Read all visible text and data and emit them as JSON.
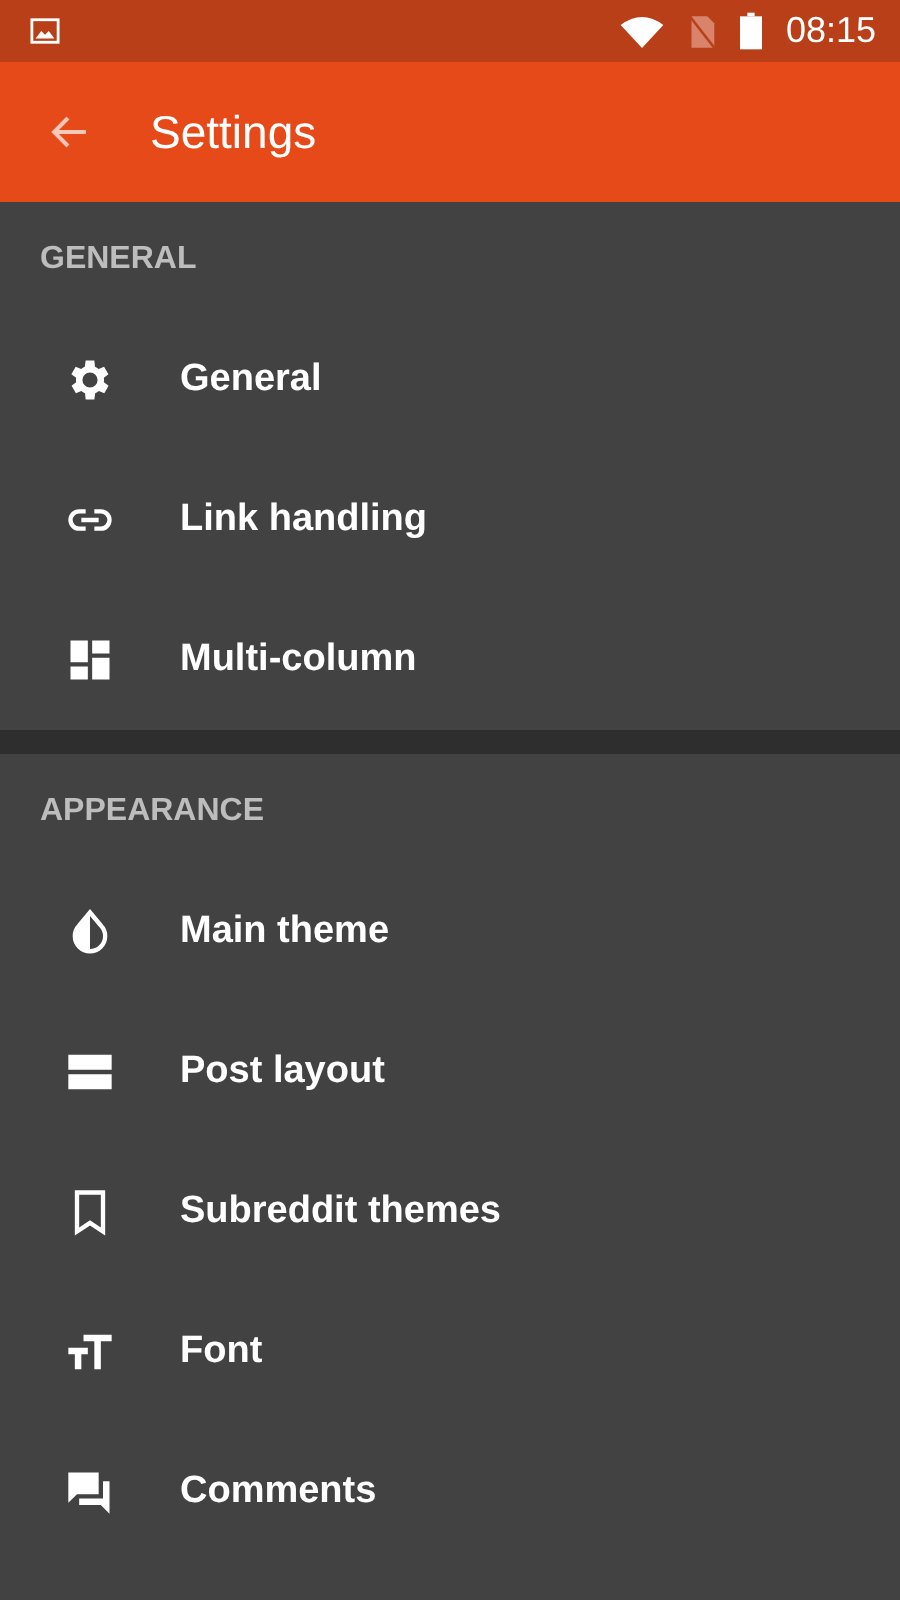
{
  "status_bar": {
    "time": "08:15"
  },
  "toolbar": {
    "title": "Settings"
  },
  "sections": [
    {
      "header": "GENERAL",
      "items": [
        {
          "label": "General",
          "kind": "gear"
        },
        {
          "label": "Link handling",
          "kind": "link"
        },
        {
          "label": "Multi-column",
          "kind": "dashboard"
        }
      ]
    },
    {
      "header": "APPEARANCE",
      "items": [
        {
          "label": "Main theme",
          "kind": "drop"
        },
        {
          "label": "Post layout",
          "kind": "rows"
        },
        {
          "label": "Subreddit themes",
          "kind": "bookmark"
        },
        {
          "label": "Font",
          "kind": "textsize"
        },
        {
          "label": "Comments",
          "kind": "comments"
        }
      ]
    }
  ]
}
